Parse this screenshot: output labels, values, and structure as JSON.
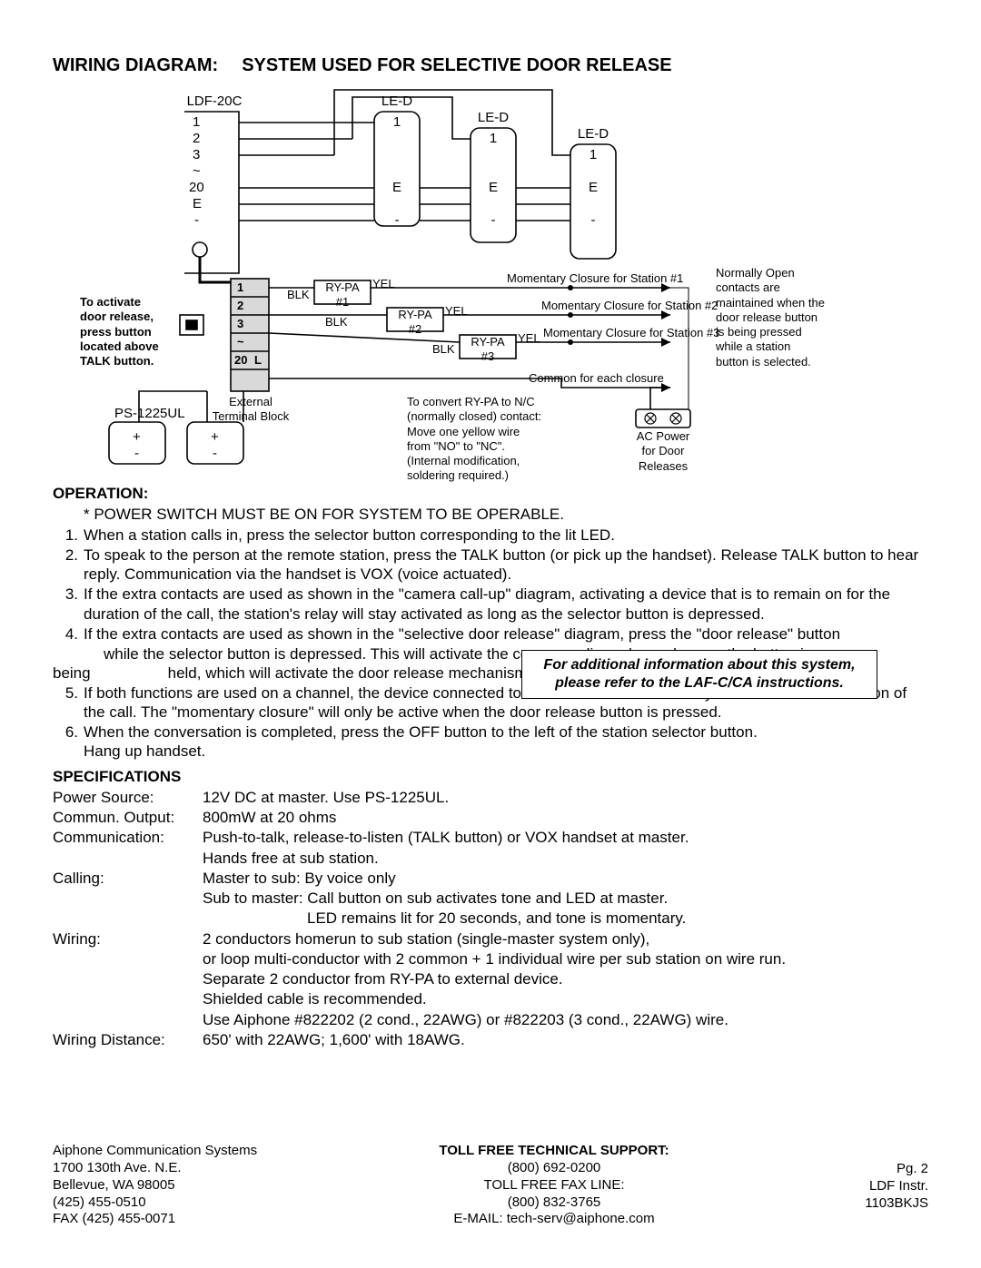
{
  "title_prefix": "WIRING DIAGRAM:",
  "title_main": "SYSTEM USED FOR SELECTIVE DOOR RELEASE",
  "diagram": {
    "ldf_label": "LDF-20C",
    "led_label": "LE-D",
    "ldf_terms": [
      "1",
      "2",
      "3",
      "~",
      "20",
      "E",
      "-"
    ],
    "led_terms": [
      "1",
      "E",
      "-"
    ],
    "ps_label": "PS-1225UL",
    "ext_tb": "External\nTerminal Block",
    "activate_note": "To activate\ndoor release,\npress button\nlocated above\nTALK button.",
    "tb_rows": [
      "1",
      "2",
      "3",
      "~",
      "20",
      "L"
    ],
    "blk": "BLK",
    "yel": "YEL",
    "rypa1": "RY-PA\n#1",
    "rypa2": "RY-PA\n#2",
    "rypa3": "RY-PA\n#3",
    "mc1": "Momentary Closure for Station #1",
    "mc2": "Momentary Closure for Station #2",
    "mc3": "Momentary Closure for Station #3",
    "common": "Common for each closure",
    "no_note": "Normally Open\ncontacts are\nmaintained when the\ndoor release button\nis being pressed\nwhile a station\nbutton is selected.",
    "nc_note": "To convert RY-PA to N/C\n(normally closed) contact:\nMove one yellow wire\nfrom \"NO\" to \"NC\".\n(Internal modification,\nsoldering required.)",
    "ac_label": "AC Power\nfor Door\nReleases",
    "plus": "+",
    "minus": "-"
  },
  "operation": {
    "heading": "OPERATION:",
    "star": "* POWER SWITCH MUST BE ON FOR SYSTEM TO BE OPERABLE.",
    "items": [
      {
        "n": "1.",
        "t": "When a station calls in, press the selector button corresponding to the lit LED."
      },
      {
        "n": "2.",
        "t": "To speak to the person at the remote station, press the TALK button (or pick up the handset).  Release TALK button to hear reply.  Communication via the handset is VOX (voice actuated)."
      },
      {
        "n": "3.",
        "t": "If the extra contacts are used as shown in the \"camera call-up\" diagram, activating a device that is to remain on for the duration of the call, the station's relay will stay activated as long as the selector button is depressed."
      },
      {
        "n": "4.",
        "t": "If the extra contacts are used as shown in the \"selective door release\" diagram, press the \"door release\" button"
      }
    ],
    "item4b_indent": "while the selector button is depressed.  This will activate the corresponding relay as long as the button is",
    "item4c": "being                  held, which will activate the door release mechanism.",
    "items2": [
      {
        "n": "5.",
        "t": "If both functions are used on a channel, the device connected to the \"constant closure\" relay will be on for the duration of the call.  The \"momentary closure\" will only be active when the door release button is pressed."
      },
      {
        "n": "6.",
        "t": "When the conversation is completed, press the OFF button to the left of the station selector button.\nHang up handset."
      }
    ]
  },
  "info_box": "For additional information about this system, please refer to the LAF-C/CA instructions.",
  "specs": {
    "heading": "SPECIFICATIONS",
    "rows": [
      {
        "k": "Power Source:",
        "v": "12V DC at master.  Use PS-1225UL."
      },
      {
        "k": "Commun. Output:",
        "v": "800mW at 20 ohms"
      },
      {
        "k": "Communication:",
        "v": "Push-to-talk, release-to-listen (TALK button) or VOX handset at master."
      },
      {
        "k": "",
        "v": "Hands free at sub station."
      },
      {
        "k": "Calling:",
        "v": "Master to sub:   By voice only"
      },
      {
        "k": "",
        "v": "Sub to master:   Call button on sub activates tone and LED at master."
      }
    ],
    "calling_sub": "LED remains lit for 20 seconds, and tone is momentary.",
    "rows2": [
      {
        "k": "Wiring:",
        "v": "2 conductors homerun to sub station (single-master system only),"
      },
      {
        "k": "",
        "v": "or loop multi-conductor with 2 common + 1 individual wire per sub station on wire run."
      },
      {
        "k": "",
        "v": "Separate 2 conductor from RY-PA to external device."
      },
      {
        "k": "",
        "v": "Shielded cable is recommended."
      },
      {
        "k": "",
        "v": "Use Aiphone #822202 (2 cond., 22AWG) or #822203 (3 cond., 22AWG) wire."
      },
      {
        "k": "Wiring Distance:",
        "v": "650' with 22AWG; 1,600' with 18AWG."
      }
    ]
  },
  "footer": {
    "left": "Aiphone Communication Systems\n1700 130th Ave. N.E.\nBellevue, WA  98005\n(425) 455-0510\nFAX (425) 455-0071",
    "mid_h": "TOLL FREE TECHNICAL SUPPORT:",
    "mid_lines": "(800) 692-0200\nTOLL FREE FAX LINE:\n(800) 832-3765\nE-MAIL: tech-serv@aiphone.com",
    "right": "Pg. 2\nLDF Instr.\n1103BKJS"
  }
}
